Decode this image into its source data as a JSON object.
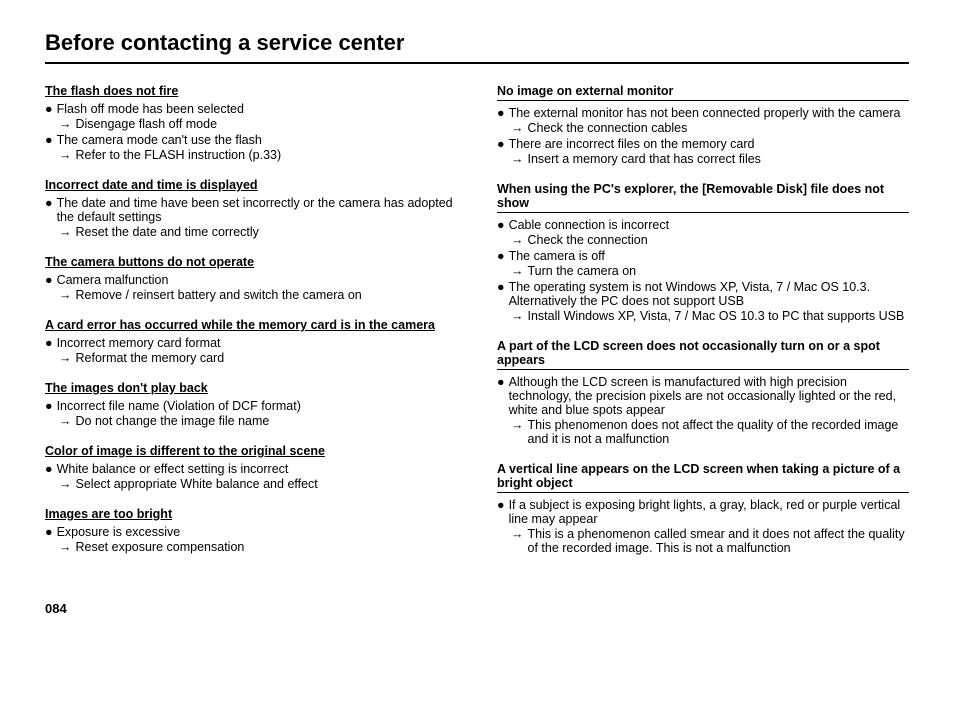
{
  "page": {
    "title": "Before contacting a service center",
    "page_number": "084"
  },
  "left_column": {
    "sections": [
      {
        "id": "flash",
        "title": "The flash does not fire",
        "title_style": "underline",
        "items": [
          {
            "type": "bullet",
            "text": "Flash off mode has been selected"
          },
          {
            "type": "arrow",
            "text": "Disengage flash off mode"
          },
          {
            "type": "bullet",
            "text": "The camera mode can't use the flash"
          },
          {
            "type": "arrow",
            "text": "Refer to the FLASH instruction (p.33)"
          }
        ]
      },
      {
        "id": "date_time",
        "title": "Incorrect date and time is displayed",
        "title_style": "underline",
        "items": [
          {
            "type": "bullet",
            "text": "The date and time have been set incorrectly or the camera has adopted the default settings"
          },
          {
            "type": "arrow",
            "text": "Reset the date and time correctly"
          }
        ]
      },
      {
        "id": "buttons",
        "title": "The camera buttons do not operate",
        "title_style": "underline",
        "items": [
          {
            "type": "bullet",
            "text": "Camera malfunction"
          },
          {
            "type": "arrow",
            "text": "Remove / reinsert battery and switch the camera on"
          }
        ]
      },
      {
        "id": "card_error",
        "title": "A card error has occurred while the memory card is in the camera",
        "title_style": "underline",
        "items": [
          {
            "type": "bullet",
            "text": "Incorrect memory card format"
          },
          {
            "type": "arrow",
            "text": "Reformat the memory card"
          }
        ]
      },
      {
        "id": "playback",
        "title": "The images don't play back",
        "title_style": "underline",
        "items": [
          {
            "type": "bullet",
            "text": "Incorrect file name (Violation of DCF format)"
          },
          {
            "type": "arrow",
            "text": "Do not change the image file name"
          }
        ]
      },
      {
        "id": "color",
        "title": "Color of image is different to the original scene",
        "title_style": "underline",
        "items": [
          {
            "type": "bullet",
            "text": "White balance or effect setting is incorrect"
          },
          {
            "type": "arrow",
            "text": "Select appropriate White balance and effect"
          }
        ]
      },
      {
        "id": "bright",
        "title": "Images are too bright",
        "title_style": "underline",
        "items": [
          {
            "type": "bullet",
            "text": "Exposure is excessive"
          },
          {
            "type": "arrow",
            "text": "Reset exposure compensation"
          }
        ]
      }
    ]
  },
  "right_column": {
    "sections": [
      {
        "id": "no_image",
        "title": "No image on external monitor",
        "title_style": "border",
        "items": [
          {
            "type": "bullet",
            "text": "The external monitor has not been connected properly with the camera"
          },
          {
            "type": "arrow",
            "text": "Check the connection cables"
          },
          {
            "type": "bullet",
            "text": "There are incorrect files on the memory card"
          },
          {
            "type": "arrow",
            "text": "Insert a memory card that has correct files"
          }
        ]
      },
      {
        "id": "removable_disk",
        "title": "When using the PC's explorer, the [Removable Disk] file does not show",
        "title_style": "border",
        "items": [
          {
            "type": "bullet",
            "text": "Cable connection is incorrect"
          },
          {
            "type": "arrow",
            "text": "Check the connection"
          },
          {
            "type": "bullet",
            "text": "The camera is off"
          },
          {
            "type": "arrow",
            "text": "Turn the camera on"
          },
          {
            "type": "bullet",
            "text": "The operating system is not Windows XP, Vista, 7 / Mac OS 10.3. Alternatively the PC does not support USB"
          },
          {
            "type": "arrow",
            "text": "Install Windows XP, Vista, 7 / Mac OS 10.3 to PC that supports USB"
          }
        ]
      },
      {
        "id": "lcd_spot",
        "title": "A part of the LCD screen does not occasionally turn on or a spot appears",
        "title_style": "border",
        "items": [
          {
            "type": "bullet",
            "text": "Although the LCD screen is manufactured with high precision technology, the precision pixels are not occasionally lighted or the red, white and blue spots appear"
          },
          {
            "type": "arrow",
            "text": "This phenomenon does not affect the quality of the recorded image and it is not a malfunction"
          }
        ]
      },
      {
        "id": "vertical_line",
        "title": "A vertical line appears on the LCD screen when taking a picture of a bright object",
        "title_style": "border",
        "items": [
          {
            "type": "bullet",
            "text": "If a subject is exposing bright lights, a gray, black, red or purple vertical line may appear"
          },
          {
            "type": "arrow",
            "text": "This is a phenomenon called smear and it does not affect the quality of the recorded image. This is not a malfunction"
          }
        ]
      }
    ]
  }
}
